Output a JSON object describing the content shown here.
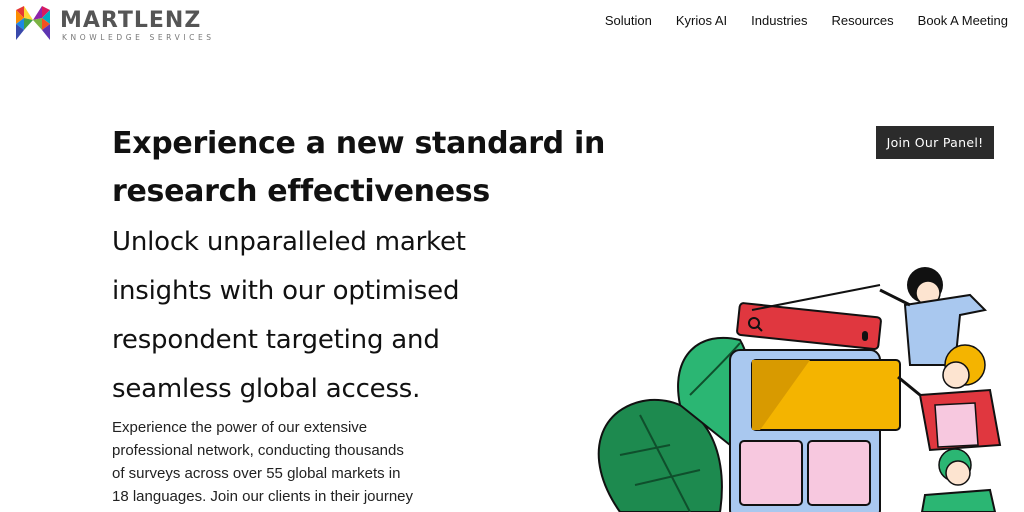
{
  "brand": {
    "name": "MARTLENZ",
    "tagline": "KNOWLEDGE SERVICES"
  },
  "nav": {
    "items": [
      "Solution",
      "Kyrios AI",
      "Industries",
      "Resources",
      "Book A Meeting"
    ]
  },
  "hero": {
    "title_line1": "Experience a new standard in",
    "title_line2": "research effectiveness",
    "subtitle_lines": [
      "Unlock unparalleled market",
      "insights with our optimised",
      "respondent targeting and",
      "seamless global access."
    ],
    "body_lines": [
      "Experience the power of our extensive",
      "professional network, conducting thousands",
      "of surveys across over 55 global markets in",
      "18 languages. Join our clients in their journey"
    ]
  },
  "cta": {
    "join_panel": "Join Our Panel!"
  },
  "colors": {
    "cta_bg": "#2b2b2b",
    "search_bar": "#e0373f",
    "card_yellow": "#f4b400",
    "card_pink": "#f7c8df",
    "phone_blue": "#a9c8ef",
    "leaf_green": "#1d8a4f"
  },
  "icons": {
    "logo": "martlenz-m-logo",
    "search": "search-icon",
    "mic": "microphone-icon"
  }
}
